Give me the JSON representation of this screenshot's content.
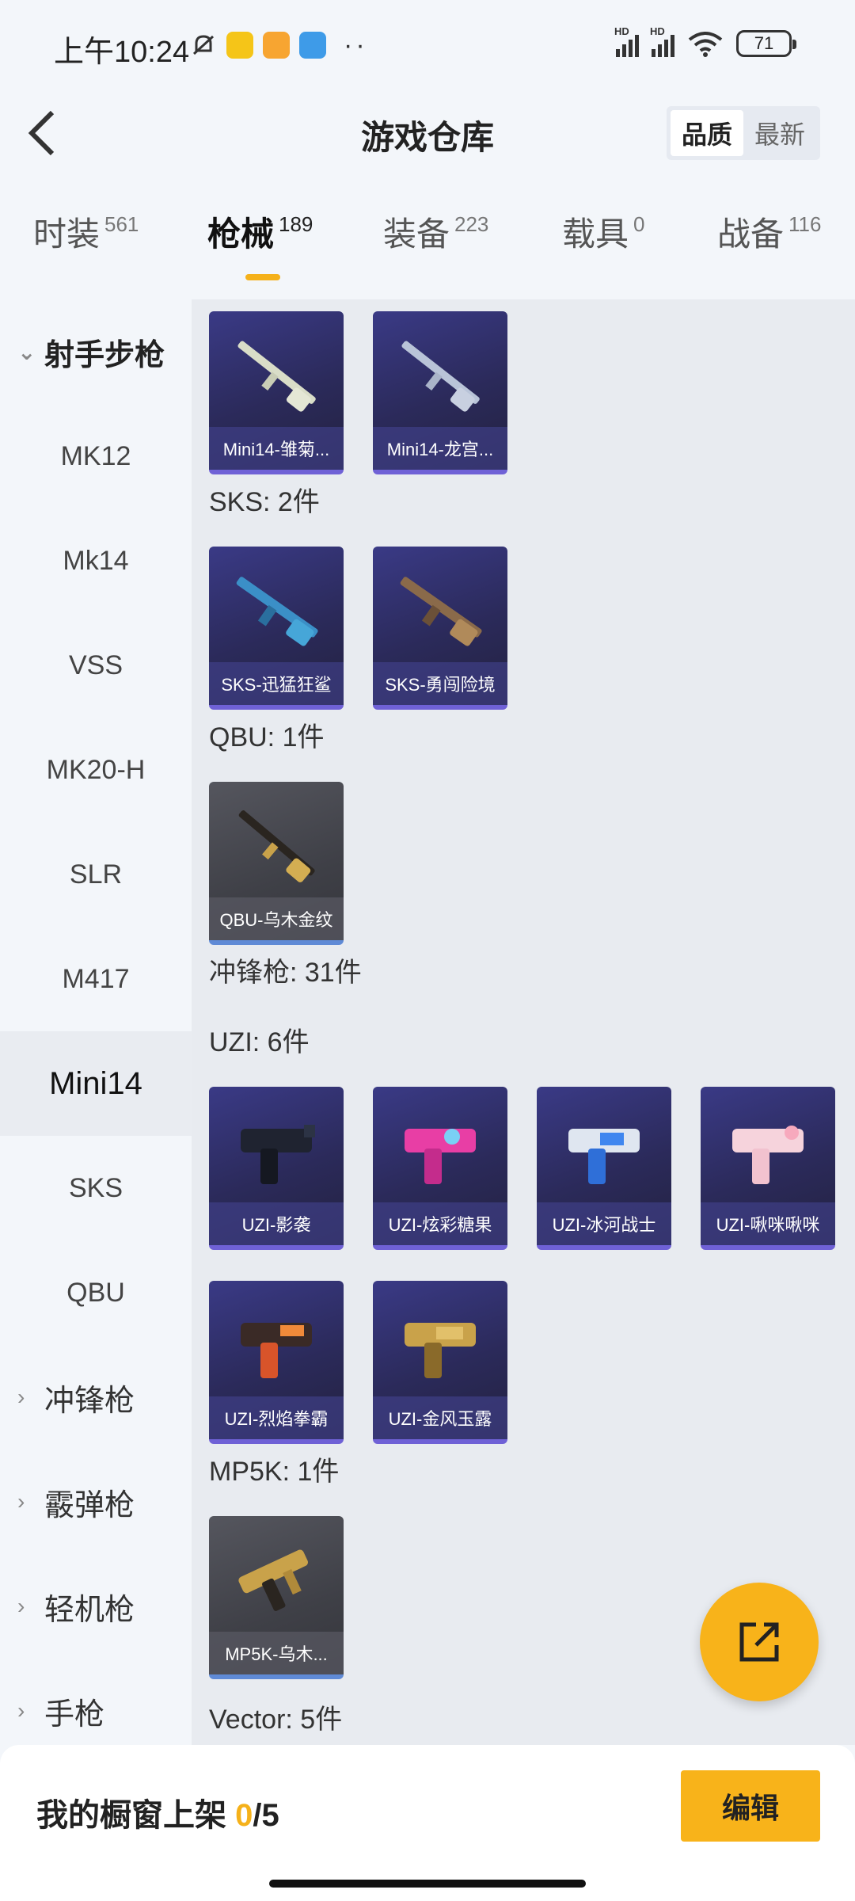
{
  "status": {
    "time": "上午10:24",
    "battery": "71",
    "net1": "HD",
    "net2": "HD"
  },
  "header": {
    "title": "游戏仓库",
    "sort": [
      "品质",
      "最新"
    ],
    "sort_active": "品质"
  },
  "tabs": [
    {
      "label": "时装",
      "count": "561"
    },
    {
      "label": "枪械",
      "count": "189"
    },
    {
      "label": "装备",
      "count": "223"
    },
    {
      "label": "载具",
      "count": "0"
    },
    {
      "label": "战备",
      "count": "116"
    }
  ],
  "sidebar": {
    "group_rifle": "射手步枪",
    "items": [
      "MK12",
      "Mk14",
      "VSS",
      "MK20-H",
      "SLR",
      "M417",
      "Mini14",
      "SKS",
      "QBU"
    ],
    "selected": "Mini14",
    "collapsed": [
      "冲锋枪",
      "霰弹枪",
      "轻机枪",
      "手枪"
    ]
  },
  "content": {
    "mini14_cards": [
      "Mini14-雏菊...",
      "Mini14-龙宫..."
    ],
    "sks_label": "SKS: 2件",
    "sks_cards": [
      "SKS-迅猛狂鲨",
      "SKS-勇闯险境"
    ],
    "qbu_label": "QBU: 1件",
    "qbu_cards": [
      "QBU-乌木金纹"
    ],
    "smg_label": "冲锋枪: 31件",
    "uzi_label": "UZI: 6件",
    "uzi_cards": [
      "UZI-影袭",
      "UZI-炫彩糖果",
      "UZI-冰河战士",
      "UZI-啾咪啾咪",
      "UZI-烈焰拳霸",
      "UZI-金风玉露"
    ],
    "mp5k_label": "MP5K: 1件",
    "mp5k_cards": [
      "MP5K-乌木..."
    ],
    "vector_label": "Vector: 5件"
  },
  "bottom": {
    "shelf_label": "我的橱窗上架",
    "shelf_used": "0",
    "shelf_total": "/5",
    "edit": "编辑"
  },
  "colors": {
    "accent": "#f8b31a",
    "card_purple": "#2b2a5a",
    "card_gray": "#3f4047"
  }
}
